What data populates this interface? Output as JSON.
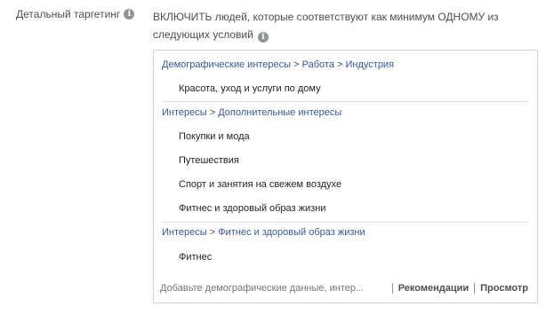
{
  "field": {
    "label": "Детальный таргетинг",
    "info_icon": "i",
    "description": "ВКЛЮЧИТЬ людей, которые соответствуют как минимум ОДНОМУ из следующих условий"
  },
  "groups": [
    {
      "path": [
        "Демографические интересы",
        "Работа",
        "Индустрия"
      ],
      "items": [
        "Красота, уход и услуги по дому"
      ]
    },
    {
      "path": [
        "Интересы",
        "Дополнительные интересы"
      ],
      "items": [
        "Покупки и мода",
        "Путешествия",
        "Спорт и занятия на свежем воздухе",
        "Фитнес и здоровый образ жизни"
      ]
    },
    {
      "path": [
        "Интересы",
        "Фитнес и здоровый образ жизни"
      ],
      "items": [
        "Фитнес"
      ]
    }
  ],
  "path_separator": ">",
  "footer": {
    "search_placeholder": "Добавьте демографические данные, интер...",
    "recommendations_label": "Рекомендации",
    "browse_label": "Просмотр"
  },
  "colors": {
    "link": "#365899",
    "text": "#1d2129",
    "muted": "#90949c",
    "border": "#ccd0d5"
  }
}
